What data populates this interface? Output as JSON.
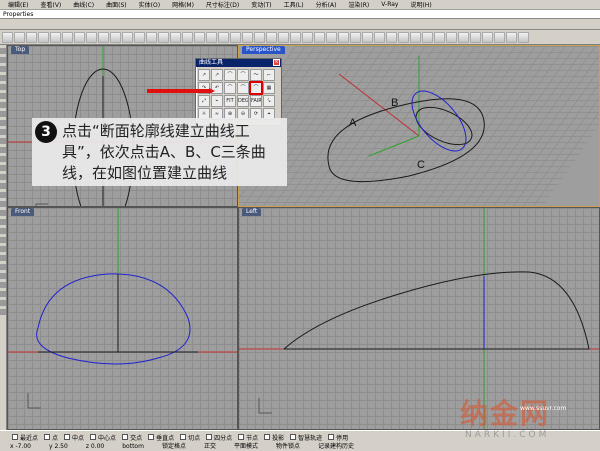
{
  "menu": [
    "编辑(E)",
    "查看(V)",
    "曲线(C)",
    "曲面(S)",
    "实体(O)",
    "网格(M)",
    "尺寸标注(D)",
    "变动(T)",
    "工具(L)",
    "分析(A)",
    "渲染(R)",
    "V-Ray",
    "说明(H)"
  ],
  "command_line": "Properties",
  "viewports": {
    "top": {
      "label": "Top"
    },
    "perspective": {
      "label": "Perspective"
    },
    "front": {
      "label": "Front"
    },
    "left": {
      "label": "Left"
    }
  },
  "curve_panel": {
    "title": "曲线工具",
    "close": "×",
    "tools": [
      "↗",
      "↗",
      "⌒",
      "⌒",
      "～",
      "⌐",
      "↷",
      "↶",
      "⌒",
      "⌒",
      "⌒",
      "▦",
      "⤢",
      "⌁",
      "FIT",
      "DEG",
      "FAIR",
      "⤥",
      "☼",
      "≈",
      "⊕",
      "⊖",
      "⟳",
      "⌖"
    ]
  },
  "labels": {
    "A": "A",
    "B": "B",
    "C": "C"
  },
  "callout": {
    "step": "3",
    "text": "点击“断面轮廓线建立曲线工具”，依次点击A、B、C三条曲线，在如图位置建立曲线"
  },
  "axis_labels": {
    "x": "x",
    "y": "y",
    "z": "z"
  },
  "osnap": [
    "最近点",
    "点",
    "中点",
    "中心点",
    "交点",
    "垂直点",
    "切点",
    "四分点",
    "节点",
    "投影",
    "智慧轨迹",
    "停用"
  ],
  "status": {
    "x": "x -7.00",
    "y": "y 2.50",
    "z": "z 0.00",
    "layer": "bottom",
    "grid_snap": "锁定格点",
    "ortho": "正交",
    "planar": "平面模式",
    "osnap": "物件锁点",
    "history": "记录建构历史"
  },
  "watermark": {
    "logo": "纳金网",
    "sub": "NARKII.COM",
    "url": "www.ssuvr.com"
  },
  "colors": {
    "curve_black": "#1a1a1a",
    "curve_blue": "#2020d0",
    "axis_red": "#c03030",
    "axis_green": "#30a030",
    "arrow_red": "#e01010"
  }
}
